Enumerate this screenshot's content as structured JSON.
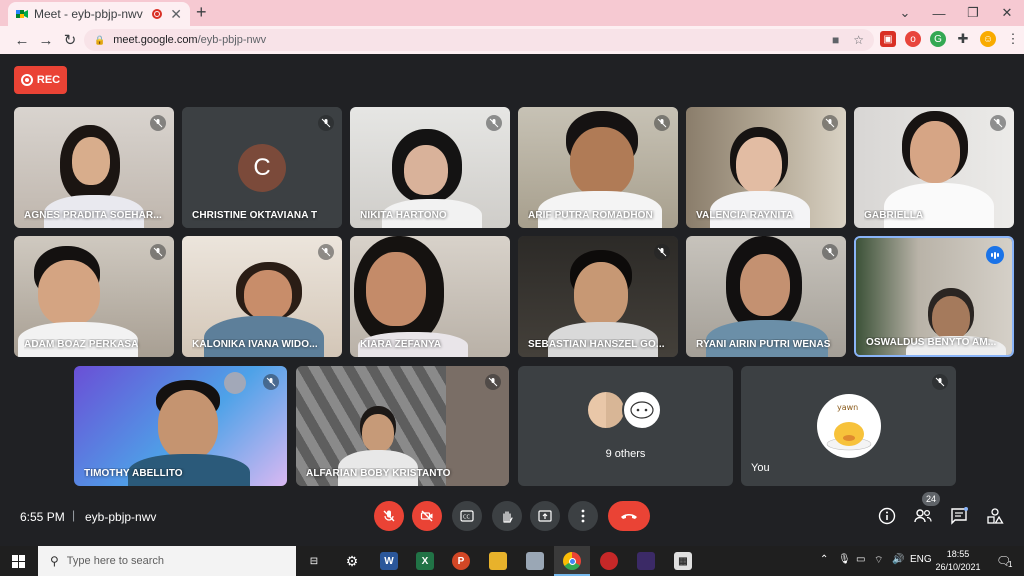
{
  "browser": {
    "tab_title": "Meet - eyb-pbjp-nwv",
    "new_tab": "+",
    "url_host": "meet.google.com",
    "url_path": "/eyb-pbjp-nwv"
  },
  "meet": {
    "rec_label": "REC",
    "time": "6:55 PM",
    "separator": "|",
    "meeting_code": "eyb-pbjp-nwv",
    "participant_count": "24",
    "others_label": "9 others",
    "you_label": "You",
    "you_avatar_text": "yawn",
    "christine_initial": "C"
  },
  "participants": [
    {
      "name": "AGNES PRADITA SOEHAR..."
    },
    {
      "name": "CHRISTINE OKTAVIANA T"
    },
    {
      "name": "NIKITA HARTONO"
    },
    {
      "name": "ARIF PUTRA ROMADHON"
    },
    {
      "name": "VALENCIA RAYNITA"
    },
    {
      "name": "GABRIELLA"
    },
    {
      "name": "ADAM BOAZ PERKASA"
    },
    {
      "name": "KALONIKA IVANA WIDO..."
    },
    {
      "name": "KIARA ZEFANYA"
    },
    {
      "name": "SEBASTIAN HANSZEL GO..."
    },
    {
      "name": "RYANI AIRIN PUTRI WENAS"
    },
    {
      "name": "OSWALDUS BENYTO AM..."
    },
    {
      "name": "TIMOTHY ABELLITO"
    },
    {
      "name": "ALFARIAN BOBY KRISTANTO"
    }
  ],
  "taskbar": {
    "search_placeholder": "Type here to search",
    "language": "ENG",
    "clock_time": "18:55",
    "clock_date": "26/10/2021",
    "notification_count": "1"
  },
  "colors": {
    "meet_red": "#ea4335",
    "meet_bg": "#202124",
    "tile_bg": "#3c4043",
    "chrome_tab_strip": "#f6c9d2",
    "active_speaker": "#1a73e8"
  }
}
